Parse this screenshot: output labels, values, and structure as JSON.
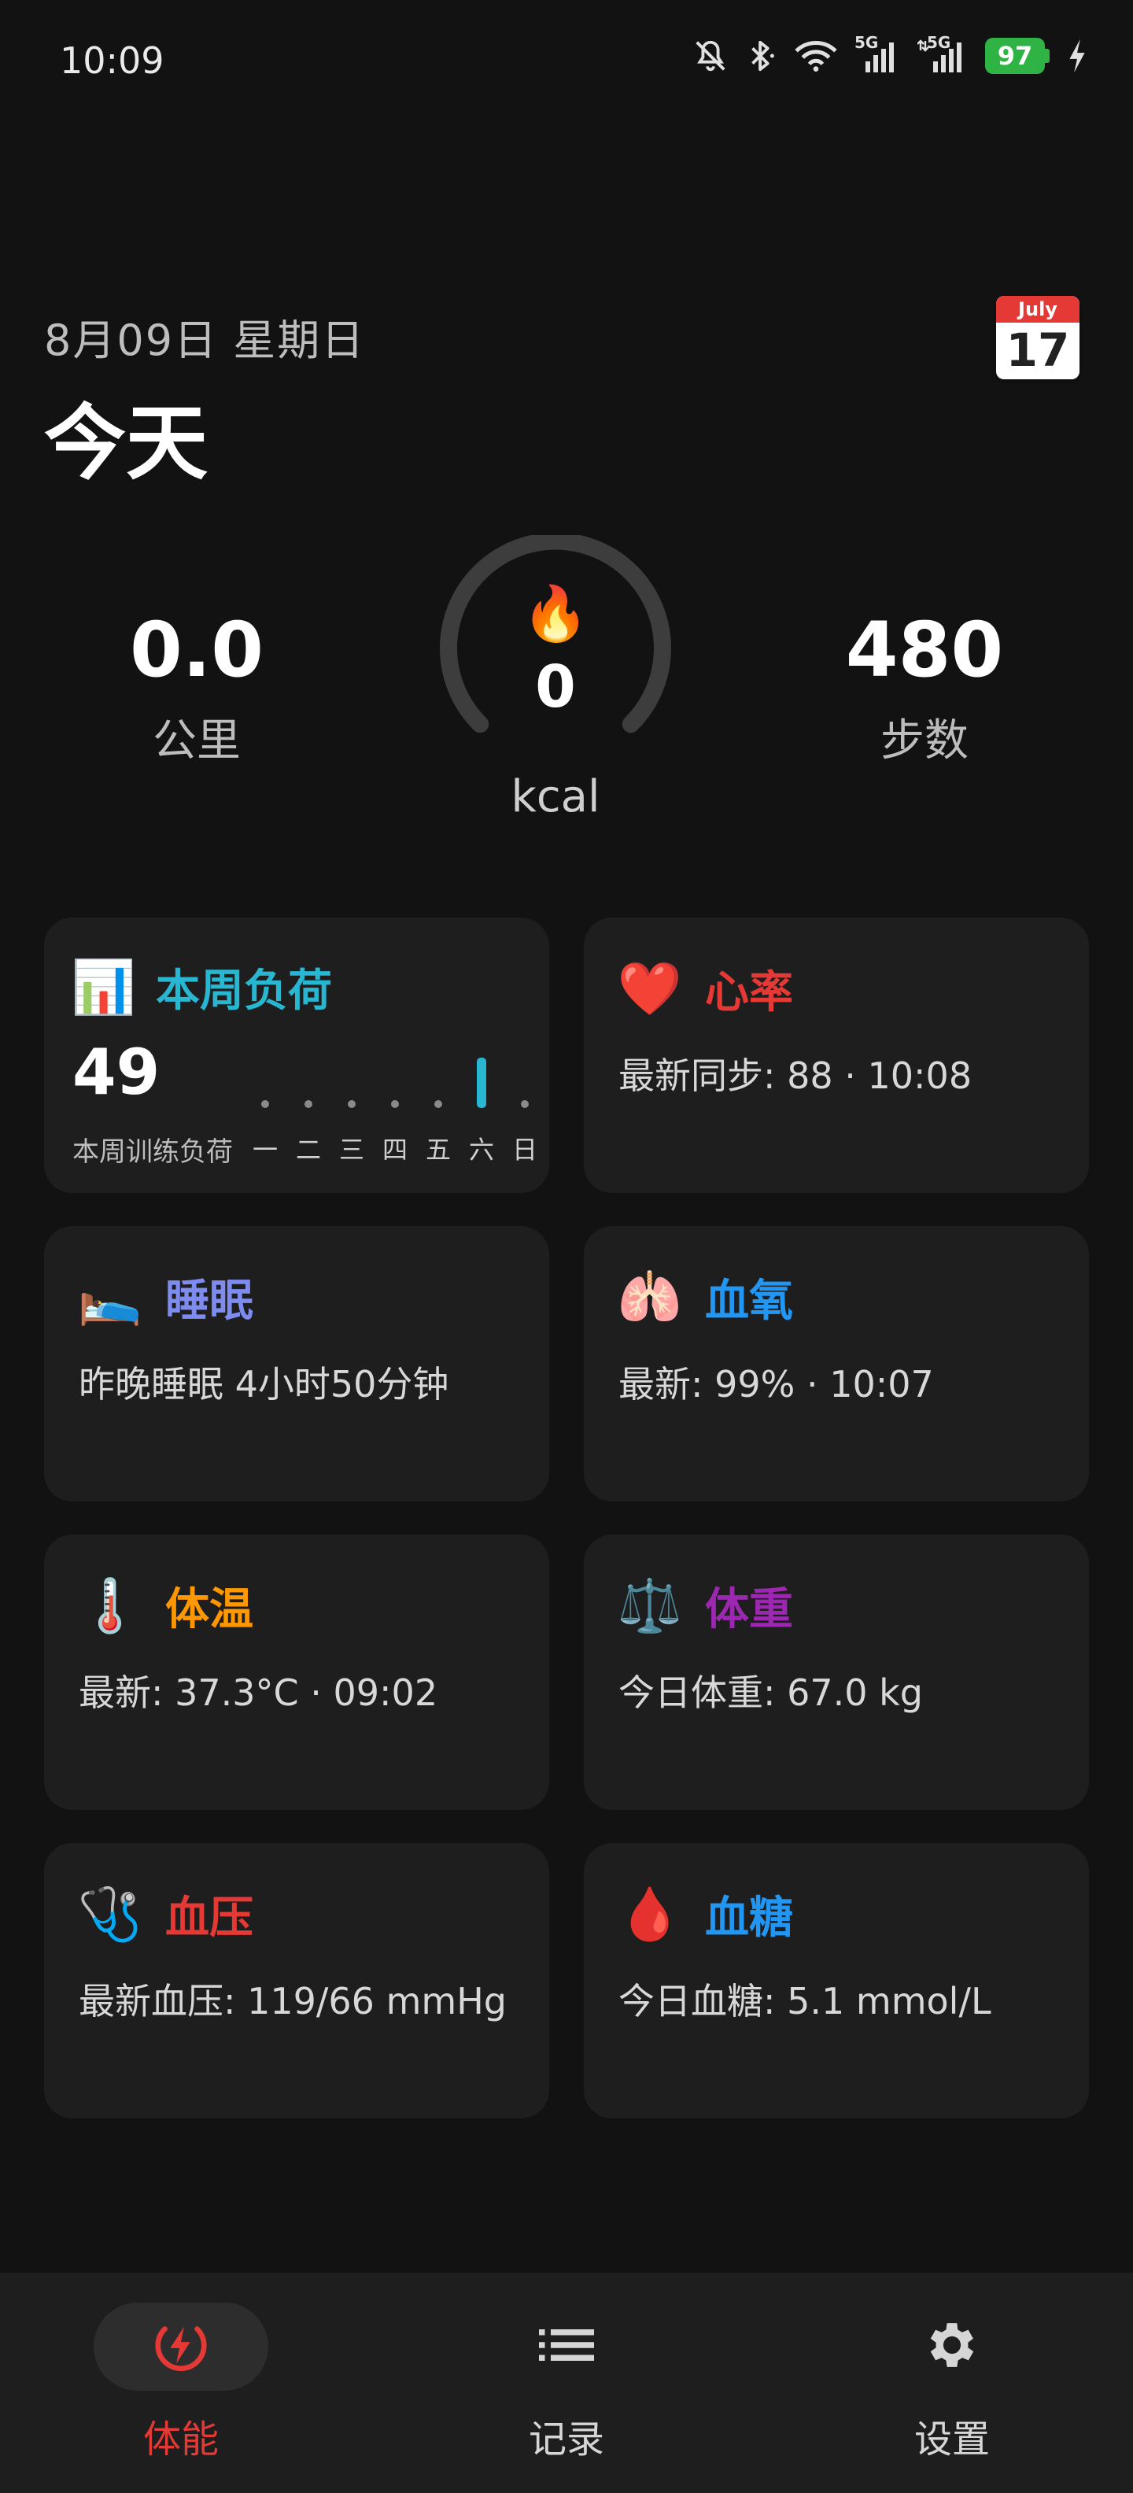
{
  "status_bar": {
    "time": "10:09",
    "network_1": "5G",
    "network_2": "5G",
    "battery": "97",
    "icons": [
      "mute-bell-icon",
      "bluetooth-icon",
      "wifi-icon",
      "signal-5g-icon",
      "signal-5g-icon",
      "battery-icon",
      "charging-icon"
    ]
  },
  "header": {
    "date": "8月09日 星期日",
    "title": "今天",
    "calendar": {
      "month": "July",
      "day": "17"
    }
  },
  "summary": {
    "distance": {
      "value": "0.0",
      "label": "公里"
    },
    "calories": {
      "value": "0",
      "unit": "kcal",
      "icon": "🔥"
    },
    "steps": {
      "value": "480",
      "label": "步数"
    }
  },
  "cards": {
    "weekly_load": {
      "icon": "📊",
      "title": "本周负荷",
      "title_color": "#29b6d1",
      "value": "49",
      "subtitle": "本周训练负荷",
      "days": [
        {
          "label": "一",
          "level": 0
        },
        {
          "label": "二",
          "level": 0
        },
        {
          "label": "三",
          "level": 0
        },
        {
          "label": "四",
          "level": 0
        },
        {
          "label": "五",
          "level": 0
        },
        {
          "label": "六",
          "level": 49
        },
        {
          "label": "日",
          "level": 0
        }
      ],
      "active_color": "#29b6d1"
    },
    "heart_rate": {
      "icon": "❤️",
      "title": "心率",
      "title_color": "#e53935",
      "text": "最新同步: 88 · 10:08"
    },
    "sleep": {
      "icon": "🛌",
      "title": "睡眠",
      "title_color": "#7e8cf0",
      "text": "昨晚睡眠 4小时50分钟"
    },
    "blood_oxygen": {
      "icon": "🫁",
      "title": "血氧",
      "title_color": "#2196f3",
      "text": "最新: 99% · 10:07"
    },
    "temperature": {
      "icon": "🌡️",
      "title": "体温",
      "title_color": "#ff9800",
      "text": "最新: 37.3°C · 09:02"
    },
    "weight": {
      "icon": "⚖️",
      "title": "体重",
      "title_color": "#9c27b0",
      "text": "今日体重: 67.0 kg"
    },
    "blood_pressure": {
      "icon": "🩺",
      "title": "血压",
      "title_color": "#e53935",
      "text": "最新血压: 119/66 mmHg"
    },
    "blood_sugar": {
      "icon": "🩸",
      "title": "血糖",
      "title_color": "#2196f3",
      "text": "今日血糖: 5.1 mmol/L"
    }
  },
  "bottom_nav": {
    "items": [
      {
        "label": "体能",
        "icon": "bolt-circle-icon",
        "active": true
      },
      {
        "label": "记录",
        "icon": "list-icon",
        "active": false
      },
      {
        "label": "设置",
        "icon": "gear-icon",
        "active": false
      }
    ],
    "active_color": "#e53935"
  }
}
